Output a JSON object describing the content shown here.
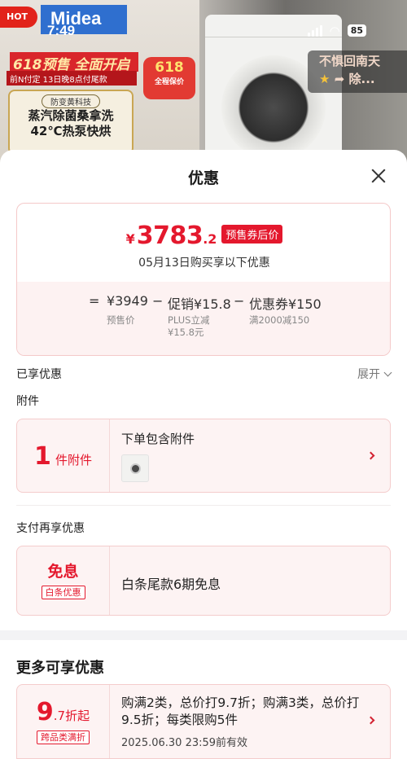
{
  "status_bar": {
    "time": "7:49",
    "battery": "85"
  },
  "banner": {
    "hot_tag": "HOT",
    "brand": "Midea",
    "sale_title": "618预售 全面开启",
    "sale_sub": "前N付定 13日晚8点付尾款",
    "tech_pill": "防变黄科技",
    "tech_line1": "蒸汽除菌桑拿洗",
    "tech_line2": "42℃热泵快烘",
    "badge_main": "618",
    "badge_sub": "全程保价",
    "promo_line1": "不惧回南天",
    "promo_line2": "除..."
  },
  "sheet": {
    "title": "优惠",
    "price_card": {
      "currency": "¥",
      "price_int": "3783",
      "price_dec": ".2",
      "price_tag": "预售券后价",
      "note": "05月13日购买享以下优惠",
      "formula": {
        "eq": "=",
        "base_price": "¥3949",
        "minus1": "−",
        "promo": "促销¥15.8",
        "minus2": "−",
        "coupon": "优惠券¥150",
        "base_label": "预售价",
        "promo_label_1": "PLUS立减",
        "promo_label_2": "¥15.8元",
        "coupon_label": "满2000减150"
      }
    },
    "enjoyed_label": "已享优惠",
    "expand_label": "展开",
    "accessory": {
      "section_label": "附件",
      "count": "1",
      "unit": "件附件",
      "desc": "下单包含附件"
    },
    "payment": {
      "section_label": "支付再享优惠",
      "big": "免息",
      "tag": "白条优惠",
      "desc": "白条尾款6期免息"
    },
    "more": {
      "title": "更多可享优惠",
      "discount_big": "9",
      "discount_small": ".7折起",
      "tag": "跨品类满折",
      "desc": "购满2类，总价打9.7折；购满3类，总价打9.5折；每类限购5件",
      "valid": "2025.06.30 23:59前有效"
    }
  },
  "colors": {
    "accent_red": "#e4182d",
    "card_bg": "#fdf3f3",
    "card_border": "#f4cccc"
  }
}
